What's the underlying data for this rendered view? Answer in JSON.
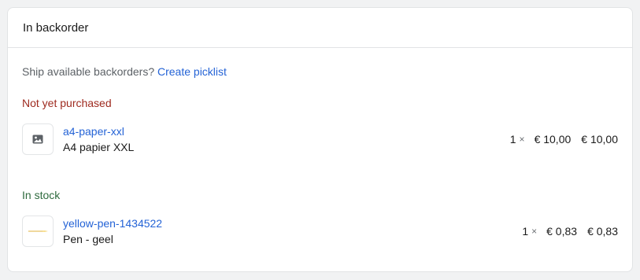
{
  "card": {
    "title": "In backorder"
  },
  "prompt": {
    "text": "Ship available backorders?",
    "link": "Create picklist"
  },
  "sections": [
    {
      "label": "Not yet purchased",
      "color": "#9e2a1f",
      "items": [
        {
          "sku": "a4-paper-xxl",
          "name": "A4 papier XXL",
          "qty": "1",
          "times": "×",
          "unit_price": "€ 10,00",
          "total": "€ 10,00",
          "thumbnail": "image-placeholder-icon"
        }
      ]
    },
    {
      "label": "In stock",
      "color": "#2f6b3f",
      "items": [
        {
          "sku": "yellow-pen-1434522",
          "name": "Pen - geel",
          "qty": "1",
          "times": "×",
          "unit_price": "€ 0,83",
          "total": "€ 0,83",
          "thumbnail": "yellow-pen-image"
        }
      ]
    }
  ]
}
